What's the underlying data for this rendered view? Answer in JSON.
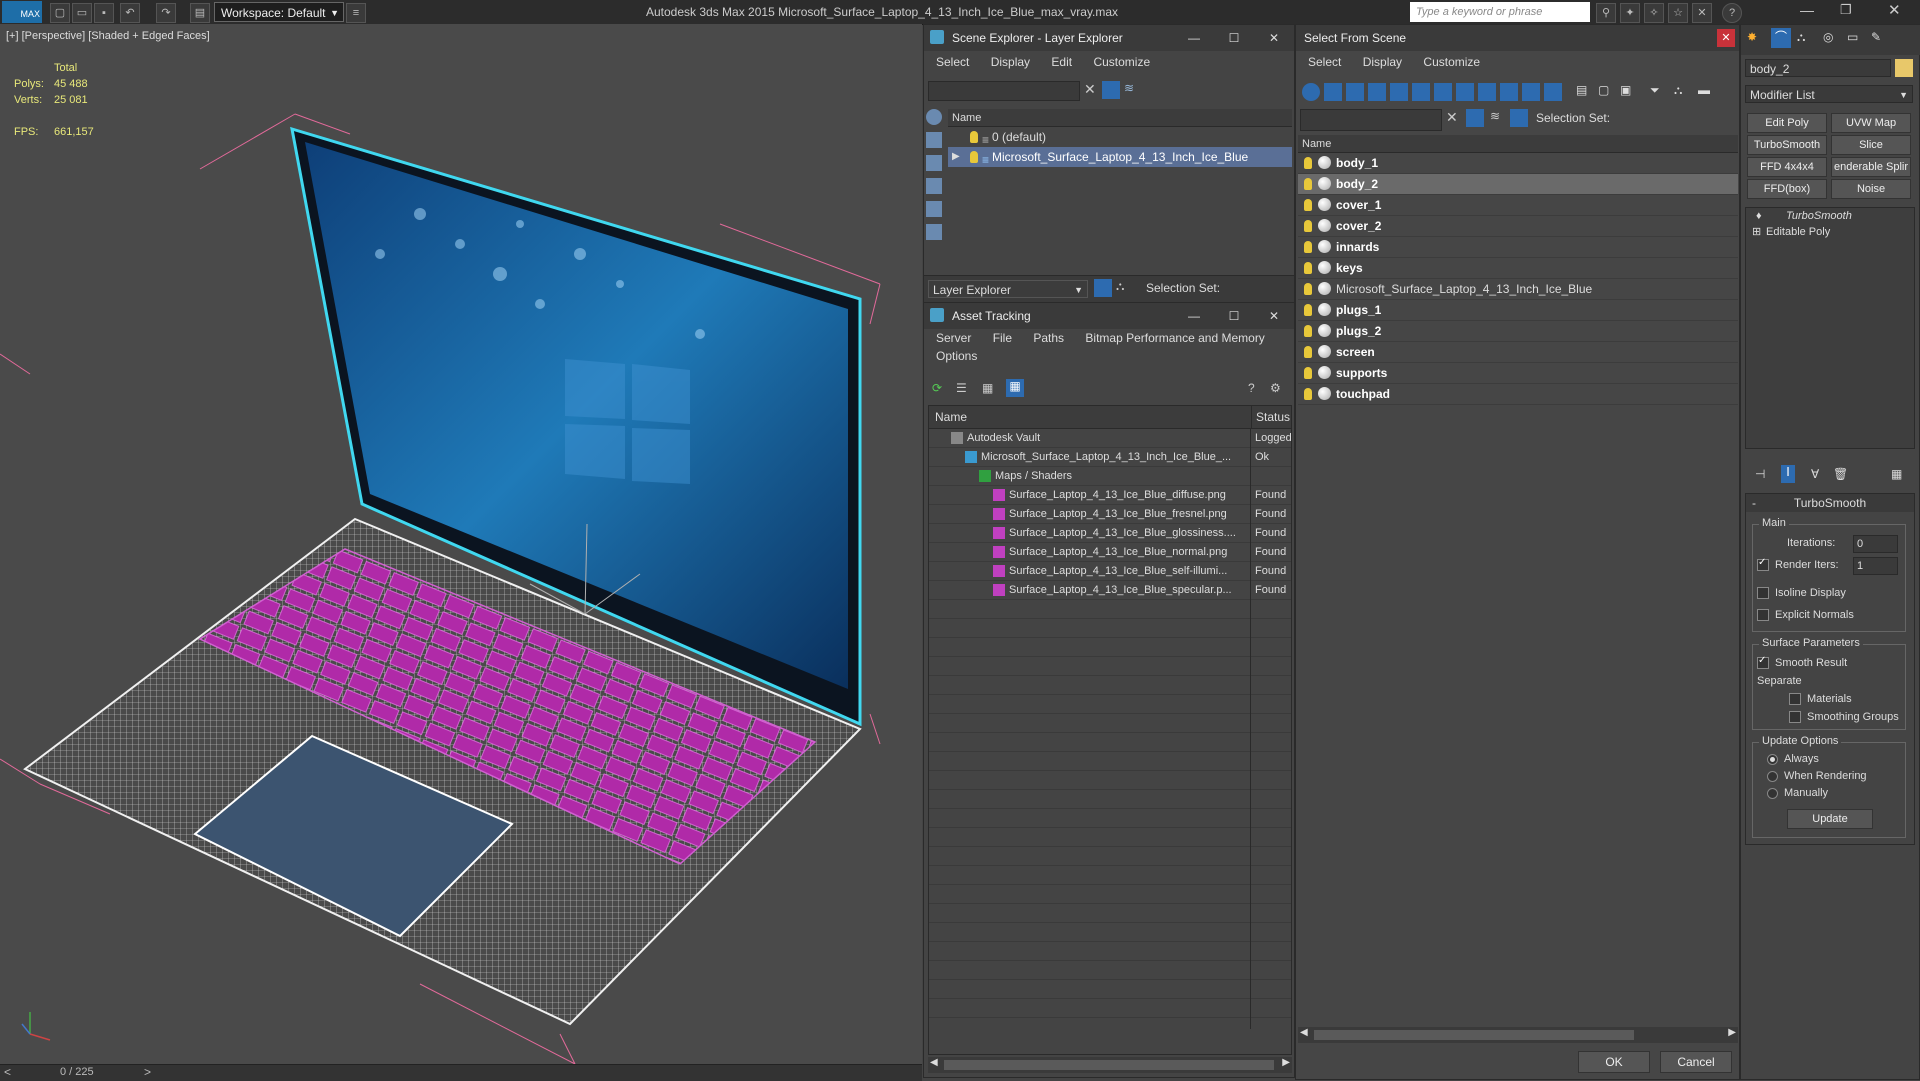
{
  "titlebar": {
    "logo_text": "MAX",
    "workspace_label": "Workspace: Default",
    "app_title": "Autodesk 3ds Max  2015     Microsoft_Surface_Laptop_4_13_Inch_Ice_Blue_max_vray.max",
    "search_placeholder": "Type a keyword or phrase"
  },
  "viewport": {
    "label": "[+] [Perspective] [Shaded + Edged Faces]",
    "stats": {
      "total_label": "Total",
      "polys_label": "Polys:",
      "polys_value": "45 488",
      "verts_label": "Verts:",
      "verts_value": "25 081",
      "fps_label": "FPS:",
      "fps_value": "661,157"
    },
    "timeline": "0 / 225",
    "colors": {
      "wire": "#ffffff",
      "keys": "#c030c0",
      "screen": "#1a6aa8",
      "frame": "#40d8f0"
    }
  },
  "scene_explorer": {
    "title": "Scene Explorer - Layer Explorer",
    "menu": [
      "Select",
      "Display",
      "Edit",
      "Customize"
    ],
    "col_name": "Name",
    "layers": [
      {
        "name": "0 (default)",
        "selected": false
      },
      {
        "name": "Microsoft_Surface_Laptop_4_13_Inch_Ice_Blue",
        "selected": true
      }
    ],
    "footer_dropdown": "Layer Explorer",
    "selection_set": "Selection Set:"
  },
  "asset_tracking": {
    "title": "Asset Tracking",
    "menu": [
      "Server",
      "File",
      "Paths",
      "Bitmap Performance and Memory"
    ],
    "menu2": [
      "Options"
    ],
    "col_name": "Name",
    "col_status": "Status",
    "rows": [
      {
        "name": "Autodesk Vault",
        "status": "Logged",
        "indent": 0
      },
      {
        "name": "Microsoft_Surface_Laptop_4_13_Inch_Ice_Blue_...",
        "status": "Ok",
        "indent": 1
      },
      {
        "name": "Maps / Shaders",
        "status": "",
        "indent": 2
      },
      {
        "name": "Surface_Laptop_4_13_Ice_Blue_diffuse.png",
        "status": "Found",
        "indent": 3
      },
      {
        "name": "Surface_Laptop_4_13_Ice_Blue_fresnel.png",
        "status": "Found",
        "indent": 3
      },
      {
        "name": "Surface_Laptop_4_13_Ice_Blue_glossiness....",
        "status": "Found",
        "indent": 3
      },
      {
        "name": "Surface_Laptop_4_13_Ice_Blue_normal.png",
        "status": "Found",
        "indent": 3
      },
      {
        "name": "Surface_Laptop_4_13_Ice_Blue_self-illumi...",
        "status": "Found",
        "indent": 3
      },
      {
        "name": "Surface_Laptop_4_13_Ice_Blue_specular.p...",
        "status": "Found",
        "indent": 3
      }
    ]
  },
  "select_from_scene": {
    "title": "Select From Scene",
    "menu": [
      "Select",
      "Display",
      "Customize"
    ],
    "selection_set": "Selection Set:",
    "col_name": "Name",
    "objects": [
      {
        "name": "body_1",
        "bold": true,
        "selected": false
      },
      {
        "name": "body_2",
        "bold": true,
        "selected": true
      },
      {
        "name": "cover_1",
        "bold": true,
        "selected": false
      },
      {
        "name": "cover_2",
        "bold": true,
        "selected": false
      },
      {
        "name": "innards",
        "bold": true,
        "selected": false
      },
      {
        "name": "keys",
        "bold": true,
        "selected": false
      },
      {
        "name": "Microsoft_Surface_Laptop_4_13_Inch_Ice_Blue",
        "bold": false,
        "selected": false
      },
      {
        "name": "plugs_1",
        "bold": true,
        "selected": false
      },
      {
        "name": "plugs_2",
        "bold": true,
        "selected": false
      },
      {
        "name": "screen",
        "bold": true,
        "selected": false
      },
      {
        "name": "supports",
        "bold": true,
        "selected": false
      },
      {
        "name": "touchpad",
        "bold": true,
        "selected": false
      }
    ],
    "ok_label": "OK",
    "cancel_label": "Cancel"
  },
  "command_panel": {
    "object_name": "body_2",
    "modifier_list": "Modifier List",
    "modifier_buttons": [
      "Edit Poly",
      "UVW Map",
      "TurboSmooth",
      "Slice",
      "FFD 4x4x4",
      "enderable Splir",
      "FFD(box)",
      "Noise"
    ],
    "stack": [
      "TurboSmooth",
      "Editable Poly"
    ],
    "rollout_title": "TurboSmooth",
    "main_label": "Main",
    "iterations_label": "Iterations:",
    "iterations_value": "0",
    "render_iters_label": "Render Iters:",
    "render_iters_value": "1",
    "isoline_label": "Isoline Display",
    "explicit_normals_label": "Explicit Normals",
    "surface_params_label": "Surface Parameters",
    "smooth_result_label": "Smooth Result",
    "separate_label": "Separate",
    "materials_label": "Materials",
    "smoothing_groups_label": "Smoothing Groups",
    "update_options_label": "Update Options",
    "always_label": "Always",
    "when_rendering_label": "When Rendering",
    "manually_label": "Manually",
    "update_button": "Update"
  }
}
